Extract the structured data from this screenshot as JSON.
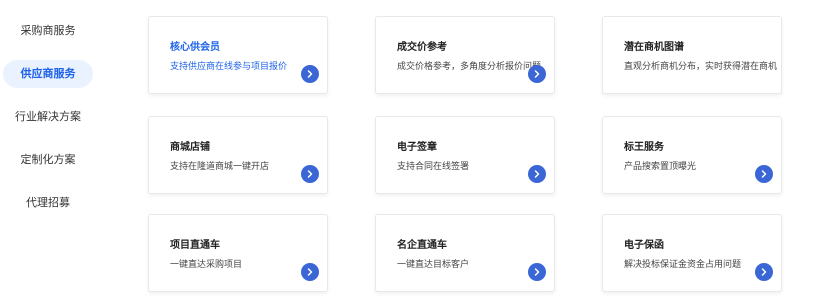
{
  "sidebar": {
    "items": [
      {
        "label": "采购商服务",
        "active": false
      },
      {
        "label": "供应商服务",
        "active": true
      },
      {
        "label": "行业解决方案",
        "active": false
      },
      {
        "label": "定制化方案",
        "active": false
      },
      {
        "label": "代理招募",
        "active": false
      }
    ]
  },
  "cards": [
    {
      "title": "核心供会员",
      "desc": "支持供应商在线参与项目报价",
      "highlight": true
    },
    {
      "title": "成交价参考",
      "desc": "成交价格参考，多角度分析报价问题",
      "highlight": false
    },
    {
      "title": "潜在商机图谱",
      "desc": "直观分析商机分布，实时获得潜在商机",
      "highlight": false
    },
    {
      "title": "商城店铺",
      "desc": "支持在隆道商城一键开店",
      "highlight": false
    },
    {
      "title": "电子签章",
      "desc": "支持合同在线签署",
      "highlight": false
    },
    {
      "title": "标王服务",
      "desc": "产品搜索置顶曝光",
      "highlight": false
    },
    {
      "title": "项目直通车",
      "desc": "一键直达采购项目",
      "highlight": false
    },
    {
      "title": "名企直通车",
      "desc": "一键直达目标客户",
      "highlight": false
    },
    {
      "title": "电子保函",
      "desc": "解决投标保证金资金占用问题",
      "highlight": false
    }
  ],
  "colors": {
    "accent": "#1d62e8",
    "active_bg": "#eaf2ff",
    "arrow_bg": "#3b66d6"
  },
  "icons": {
    "arrow": "chevron-right-icon"
  }
}
